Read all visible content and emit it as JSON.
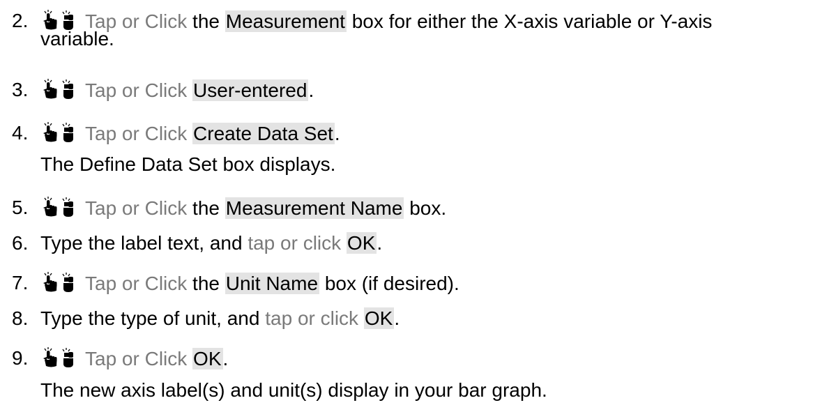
{
  "steps": [
    {
      "number": "2.",
      "has_icon": true,
      "action": "Tap or Click",
      "t1": "the",
      "ui": "Measurement",
      "t2": "box for either the X-axis variable or Y-axis",
      "continuation": "variable."
    },
    {
      "number": "3.",
      "has_icon": true,
      "action": "Tap or Click",
      "ui": "User-entered",
      "t2": "."
    },
    {
      "number": "4.",
      "has_icon": true,
      "action": "Tap or Click",
      "ui": "Create Data Set",
      "t2": ".",
      "note": {
        "bold": "Define Data Set",
        "before": "The",
        "after": "box displays."
      }
    },
    {
      "number": "5.",
      "has_icon": true,
      "action": "Tap or Click",
      "t1": "the",
      "ui": "Measurement Name",
      "t2": "box."
    },
    {
      "number": "6.",
      "has_icon": false,
      "text": "Type the label text, and",
      "action": "tap or click",
      "ui": "OK",
      "t2": "."
    },
    {
      "number": "7.",
      "has_icon": true,
      "action": "Tap or Click",
      "t1": "the",
      "ui": "Unit Name",
      "t2": "box (if desired)."
    },
    {
      "number": "8.",
      "has_icon": false,
      "text": "Type the type of unit, and",
      "action": "tap or click",
      "ui": "OK",
      "t2": "."
    },
    {
      "number": "9.",
      "has_icon": true,
      "action": "Tap or Click",
      "ui": "OK",
      "t2": ".",
      "note_plain": "The new axis label(s) and unit(s) display in your bar graph."
    }
  ],
  "icons": {
    "touch": "touch-hand-icon",
    "mouse": "mouse-icon"
  },
  "colors": {
    "action_text": "#7a7a7a",
    "ui_highlight": "#e3e3e3",
    "body_text": "#000000"
  }
}
